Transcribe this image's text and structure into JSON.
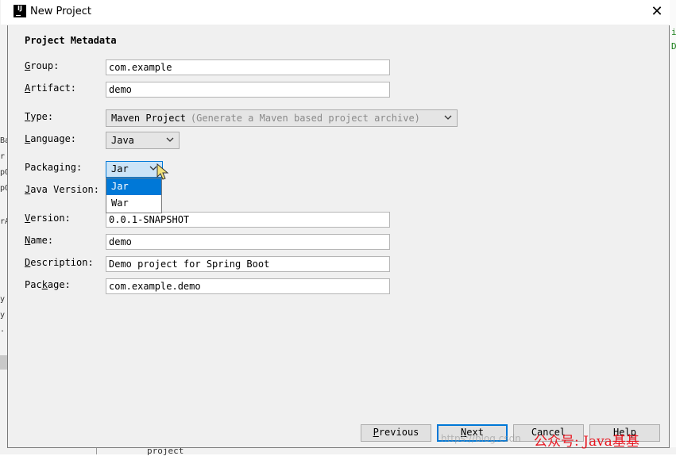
{
  "window": {
    "title": "New Project",
    "close_symbol": "✕"
  },
  "section_title": "Project Metadata",
  "fields": {
    "group": {
      "label_key": "G",
      "label_rest": "roup:",
      "value": "com.example"
    },
    "artifact": {
      "label_key": "A",
      "label_rest": "rtifact:",
      "value": "demo"
    },
    "type": {
      "label_key": "T",
      "label_rest": "ype:",
      "value": "Maven Project",
      "hint": "(Generate a Maven based project archive)"
    },
    "language": {
      "label_key": "L",
      "label_rest": "anguage:",
      "value": "Java"
    },
    "packaging": {
      "label": "Packaging:",
      "value": "Jar",
      "options": [
        "Jar",
        "War"
      ],
      "selected_option": "Jar"
    },
    "java_version": {
      "label_key": "J",
      "label_rest": "ava Version:"
    },
    "version": {
      "label_key": "V",
      "label_rest": "ersion:",
      "value": "0.0.1-SNAPSHOT"
    },
    "name": {
      "label_key": "N",
      "label_rest": "ame:",
      "value": "demo"
    },
    "description": {
      "label_key": "D",
      "label_rest": "escription:",
      "value": "Demo project for Spring Boot"
    },
    "package": {
      "label_key": "k",
      "label_pre": "Pac",
      "label_rest": "age:",
      "value": "com.example.demo"
    }
  },
  "buttons": {
    "previous": {
      "key": "P",
      "rest": "revious"
    },
    "next": {
      "key": "N",
      "rest": "ext"
    },
    "cancel": "Cancel",
    "help": "Help"
  },
  "watermark": "公众号: Java基基",
  "faint_url": "https://blog.csdn",
  "background": {
    "bottom_text": "project",
    "left_frags": [
      "Ba",
      "r",
      "pO",
      "pO",
      "rA",
      "y",
      "y",
      "."
    ],
    "right_frags": [
      "i",
      "D."
    ]
  },
  "colors": {
    "accent": "#0078d7",
    "watermark": "#e8141e"
  }
}
